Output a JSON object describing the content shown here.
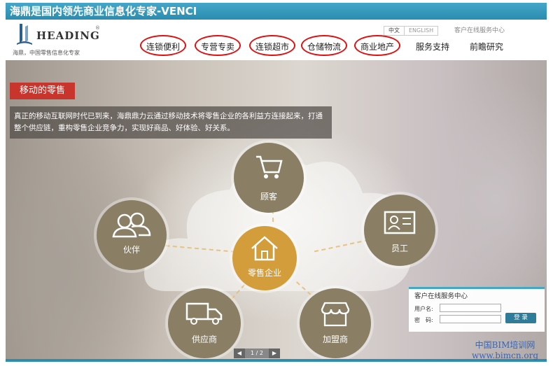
{
  "title_bar": {
    "text": "海鼎是国内领先商业信息化专家-VENCI"
  },
  "header": {
    "logo_text": "HEADING",
    "logo_reg": "®",
    "slogan": "海鼎，中国零售信息化专家",
    "lang": {
      "cn": "中文",
      "en": "ENGLISH"
    },
    "service_link": "客户在线服务中心",
    "nav": [
      "连锁便利",
      "专营专卖",
      "连锁超市",
      "仓储物流",
      "商业地产",
      "服务支持",
      "前瞻研究"
    ]
  },
  "banner": {
    "tag": "移动的零售",
    "description": "真正的移动互联网时代已到来，海鼎鼎力云通过移动技术将零售企业的各利益方连接起来，打通整个供应链，重构零售企业竞争力，实现好商品、好体验、好关系。",
    "center_label": "零售企业",
    "nodes": {
      "customer": "顾客",
      "partner": "伙伴",
      "staff": "员工",
      "supplier": "供应商",
      "franchise": "加盟商"
    },
    "pager": {
      "text": "1 / 2",
      "prev": "◀",
      "next": "▶"
    }
  },
  "login": {
    "title": "客户在线服务中心",
    "user_label": "用户名:",
    "pass_label": "密　码:",
    "submit": "登 录"
  },
  "watermark": {
    "line1": "中国BIM培训网",
    "line2": "www.bimcn.org"
  }
}
